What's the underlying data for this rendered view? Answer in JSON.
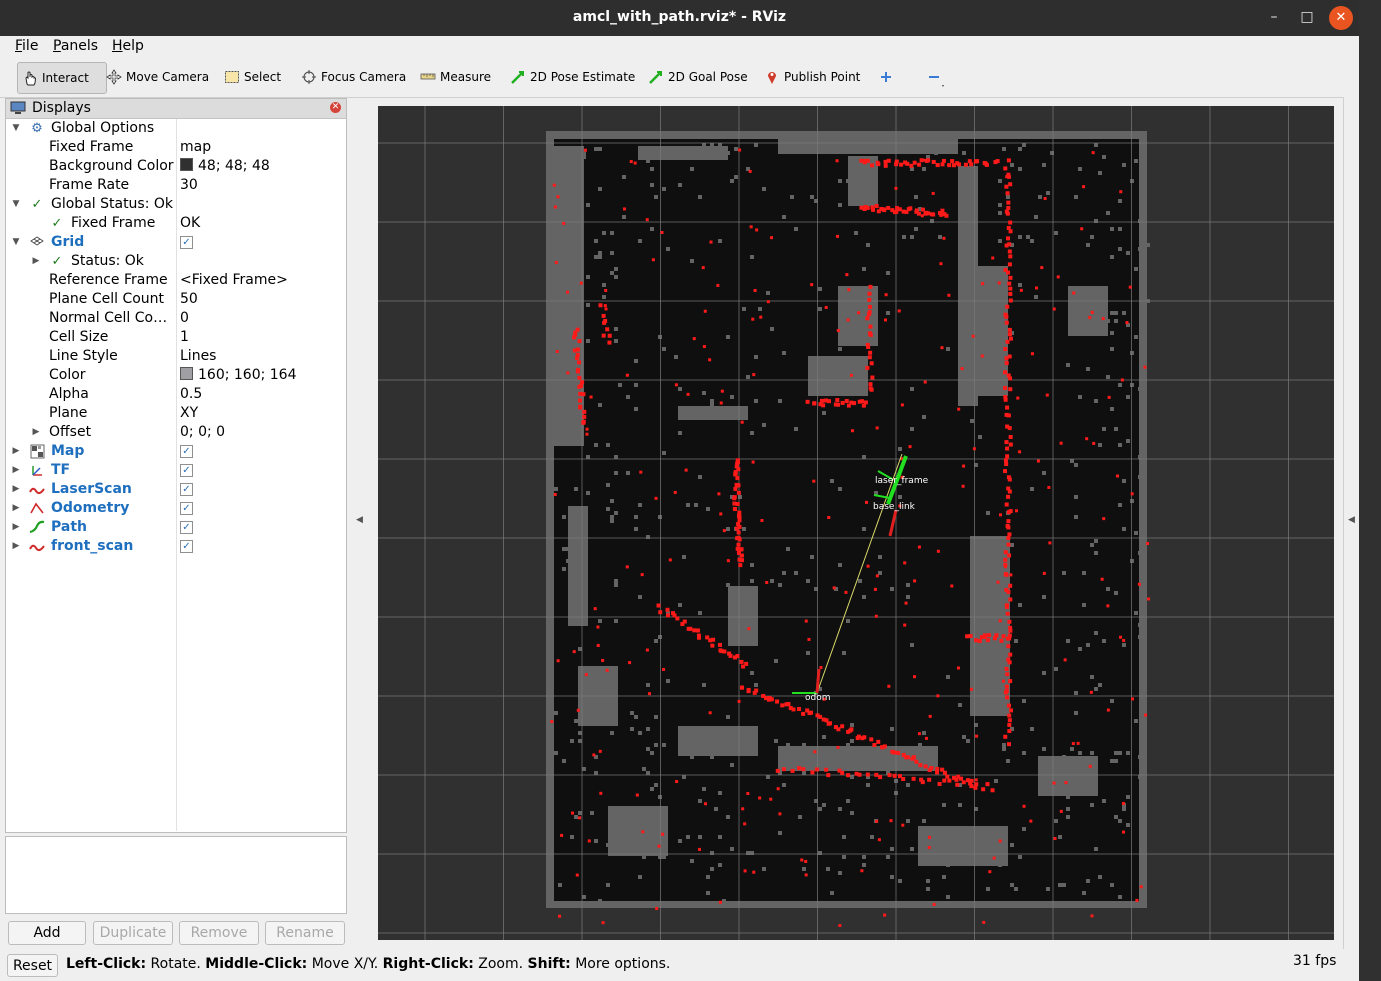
{
  "window": {
    "title": "amcl_with_path.rviz* - RViz",
    "controls": {
      "minimize": "–",
      "maximize": "□",
      "close": "✕"
    }
  },
  "menu": {
    "items": [
      {
        "label": "File",
        "mnemonic": "F"
      },
      {
        "label": "Panels",
        "mnemonic": "P"
      },
      {
        "label": "Help",
        "mnemonic": "H"
      }
    ]
  },
  "toolbar": {
    "tools": [
      {
        "label": "Interact",
        "icon": "hand-pointer-icon",
        "active": true
      },
      {
        "label": "Move Camera",
        "icon": "move-camera-icon",
        "active": false
      },
      {
        "label": "Select",
        "icon": "select-rectangle-icon",
        "active": false
      },
      {
        "label": "Focus Camera",
        "icon": "focus-camera-icon",
        "active": false
      },
      {
        "label": "Measure",
        "icon": "ruler-icon",
        "active": false
      },
      {
        "label": "2D Pose Estimate",
        "icon": "green-arrow-icon",
        "active": false
      },
      {
        "label": "2D Goal Pose",
        "icon": "green-arrow-icon",
        "active": false
      },
      {
        "label": "Publish Point",
        "icon": "map-pin-icon",
        "active": false
      }
    ],
    "add_tool_icon": "plus-icon",
    "remove_tool_icon": "minus-icon"
  },
  "displays": {
    "title": "Displays",
    "global_options": {
      "label": "Global Options",
      "fixed_frame_label": "Fixed Frame",
      "fixed_frame": "map",
      "background_color_label": "Background Color",
      "background_color": "48; 48; 48",
      "background_swatch": "#303030",
      "frame_rate_label": "Frame Rate",
      "frame_rate": "30"
    },
    "global_status": {
      "label": "Global Status: Ok",
      "fixed_frame_label": "Fixed Frame",
      "fixed_frame_value": "OK"
    },
    "grid": {
      "label": "Grid",
      "status_label": "Status: Ok",
      "reference_frame_label": "Reference Frame",
      "reference_frame": "<Fixed Frame>",
      "plane_cell_count_label": "Plane Cell Count",
      "plane_cell_count": "50",
      "normal_cell_count_label": "Normal Cell Co…",
      "normal_cell_count": "0",
      "cell_size_label": "Cell Size",
      "cell_size": "1",
      "line_style_label": "Line Style",
      "line_style": "Lines",
      "color_label": "Color",
      "color": "160; 160; 164",
      "color_swatch": "#a0a0a4",
      "alpha_label": "Alpha",
      "alpha": "0.5",
      "plane_label": "Plane",
      "plane": "XY",
      "offset_label": "Offset",
      "offset": "0; 0; 0"
    },
    "items": [
      {
        "label": "Map",
        "icon": "map-icon"
      },
      {
        "label": "TF",
        "icon": "tf-axes-icon"
      },
      {
        "label": "LaserScan",
        "icon": "laserscan-icon"
      },
      {
        "label": "Odometry",
        "icon": "odometry-icon"
      },
      {
        "label": "Path",
        "icon": "path-icon"
      },
      {
        "label": "front_scan",
        "icon": "laserscan-icon"
      }
    ],
    "buttons": {
      "add": "Add",
      "duplicate": "Duplicate",
      "remove": "Remove",
      "rename": "Rename"
    }
  },
  "viewport": {
    "background": "#303030",
    "map_color": "#0f0f0f",
    "occupied_color": "#646464",
    "scan_color": "#ff1a1a",
    "grid_color": "#7a7a7c",
    "frames": [
      {
        "label": "laser_frame"
      },
      {
        "label": "base_link"
      },
      {
        "label": "odom"
      }
    ]
  },
  "status": {
    "reset_label": "Reset",
    "left_key": "Left-Click:",
    "left_action": "Rotate.",
    "middle_key": "Middle-Click:",
    "middle_action": "Move X/Y.",
    "right_key": "Right-Click:",
    "right_action": "Zoom.",
    "shift_key": "Shift:",
    "shift_action": "More options.",
    "fps": "31 fps"
  }
}
